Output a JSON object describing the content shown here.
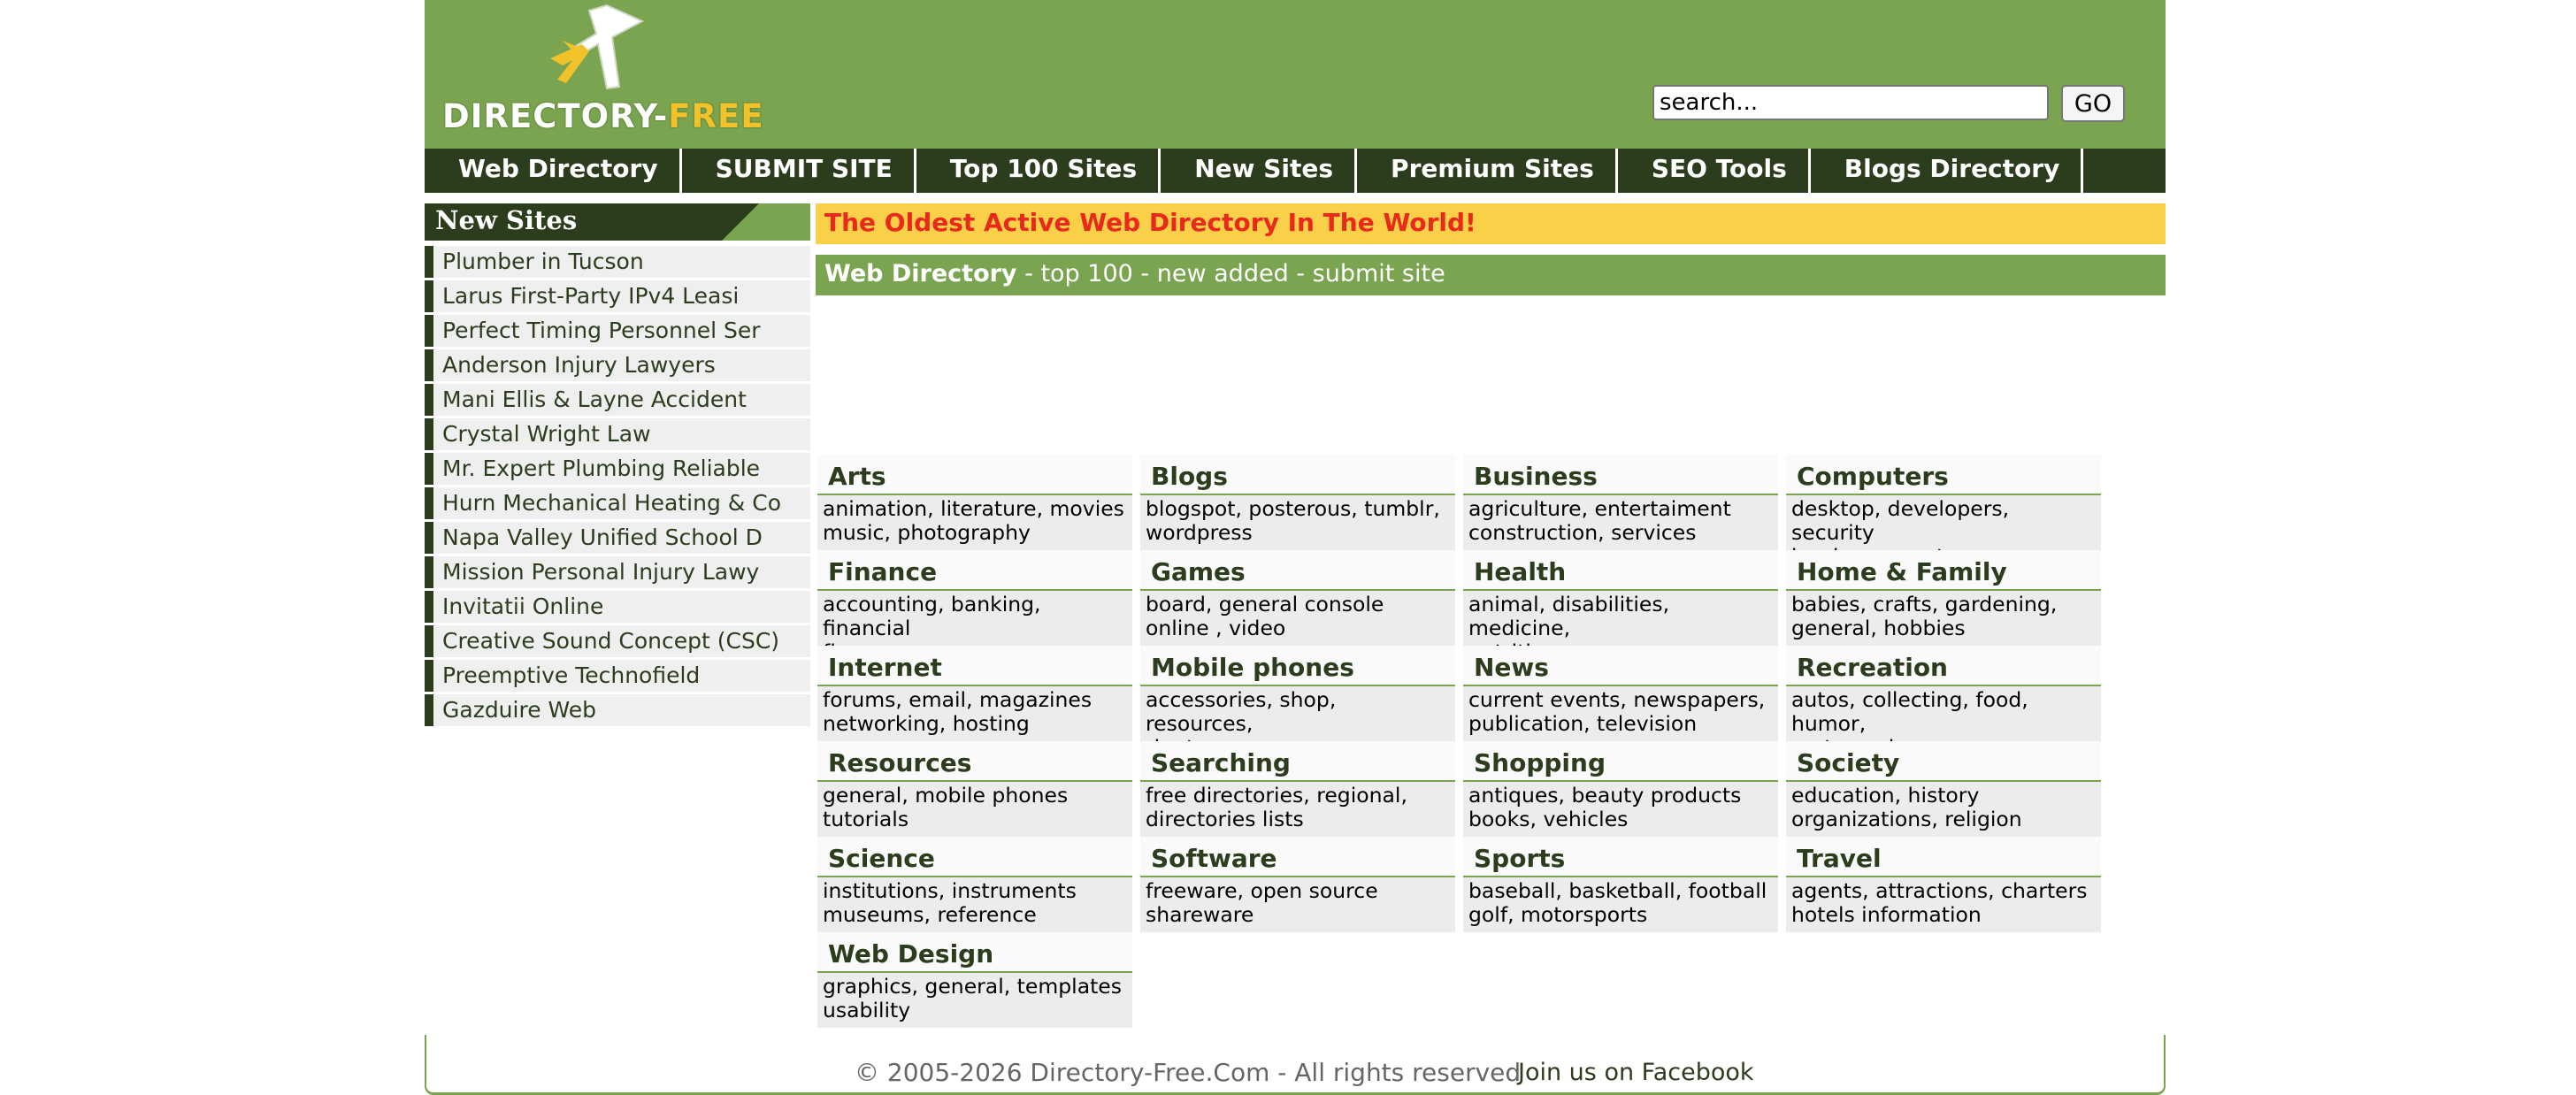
{
  "brand": {
    "logo_part1": "DIRECTORY-",
    "logo_part2": "FREE"
  },
  "search": {
    "value": "search...",
    "button_label": "GO"
  },
  "nav": [
    {
      "label": "Web Directory"
    },
    {
      "label": "SUBMIT SITE"
    },
    {
      "label": "Top 100 Sites"
    },
    {
      "label": "New Sites"
    },
    {
      "label": "Premium Sites"
    },
    {
      "label": "SEO Tools"
    },
    {
      "label": "Blogs Directory"
    }
  ],
  "sidebar": {
    "title": "New Sites",
    "items": [
      "Plumber in Tucson",
      "Larus First-Party IPv4 Leasi",
      "Perfect Timing Personnel Ser",
      "Anderson Injury Lawyers",
      "Mani Ellis & Layne Accident",
      "Crystal Wright Law",
      "Mr. Expert Plumbing Reliable",
      "Hurn Mechanical Heating & Co",
      "Napa Valley Unified School D",
      "Mission Personal Injury Lawy",
      "Invitatii Online",
      "Creative Sound Concept (CSC)",
      "Preemptive Technofield",
      "Gazduire Web"
    ]
  },
  "banner": {
    "text": "The Oldest Active Web Directory In The World!"
  },
  "subnav": {
    "home": "Web Directory",
    "sep": " - ",
    "links": [
      "top 100",
      "new added",
      "submit site"
    ]
  },
  "categories": [
    {
      "name": "Arts",
      "sub": "animation, literature, movies\nmusic, photography"
    },
    {
      "name": "Blogs",
      "sub": "blogspot, posterous, tumblr,\nwordpress"
    },
    {
      "name": "Business",
      "sub": "agriculture, entertaiment\nconstruction, services"
    },
    {
      "name": "Computers",
      "sub": "desktop, developers, security\nhardware, systems"
    },
    {
      "name": "Finance",
      "sub": "accounting, banking, financial\nfinance, morgages"
    },
    {
      "name": "Games",
      "sub": "board, general console\nonline , video"
    },
    {
      "name": "Health",
      "sub": "animal, disabilities, medicine,\nnutritions"
    },
    {
      "name": "Home & Family",
      "sub": "babies, crafts, gardening,\ngeneral, hobbies"
    },
    {
      "name": "Internet",
      "sub": "forums, email, magazines\nnetworking, hosting"
    },
    {
      "name": "Mobile phones",
      "sub": "accessories, shop, resources,\nringtones"
    },
    {
      "name": "News",
      "sub": "current events, newspapers,\npublication, television"
    },
    {
      "name": "Recreation",
      "sub": "autos, collecting, food, humor,\nmotorcycles"
    },
    {
      "name": "Resources",
      "sub": "general, mobile phones\ntutorials"
    },
    {
      "name": "Searching",
      "sub": "free directories, regional,\ndirectories lists"
    },
    {
      "name": "Shopping",
      "sub": "antiques, beauty products\nbooks, vehicles"
    },
    {
      "name": "Society",
      "sub": "education, history\norganizations, religion"
    },
    {
      "name": "Science",
      "sub": "institutions, instruments\nmuseums, reference"
    },
    {
      "name": "Software",
      "sub": "freeware, open source\nshareware"
    },
    {
      "name": "Sports",
      "sub": "baseball, basketball, football\ngolf, motorsports"
    },
    {
      "name": "Travel",
      "sub": "agents, attractions, charters\nhotels information"
    },
    {
      "name": "Web Design",
      "sub": "graphics, general, templates\nusability"
    }
  ],
  "footer": {
    "copyright": "© 2005-2026 Directory-Free.Com - All rights reserved",
    "facebook": "Join us on Facebook"
  },
  "colors": {
    "green": "#7aa450",
    "dark_green": "#2c3d1e",
    "banner_yellow": "#fbd049",
    "banner_red": "#e8291b"
  }
}
